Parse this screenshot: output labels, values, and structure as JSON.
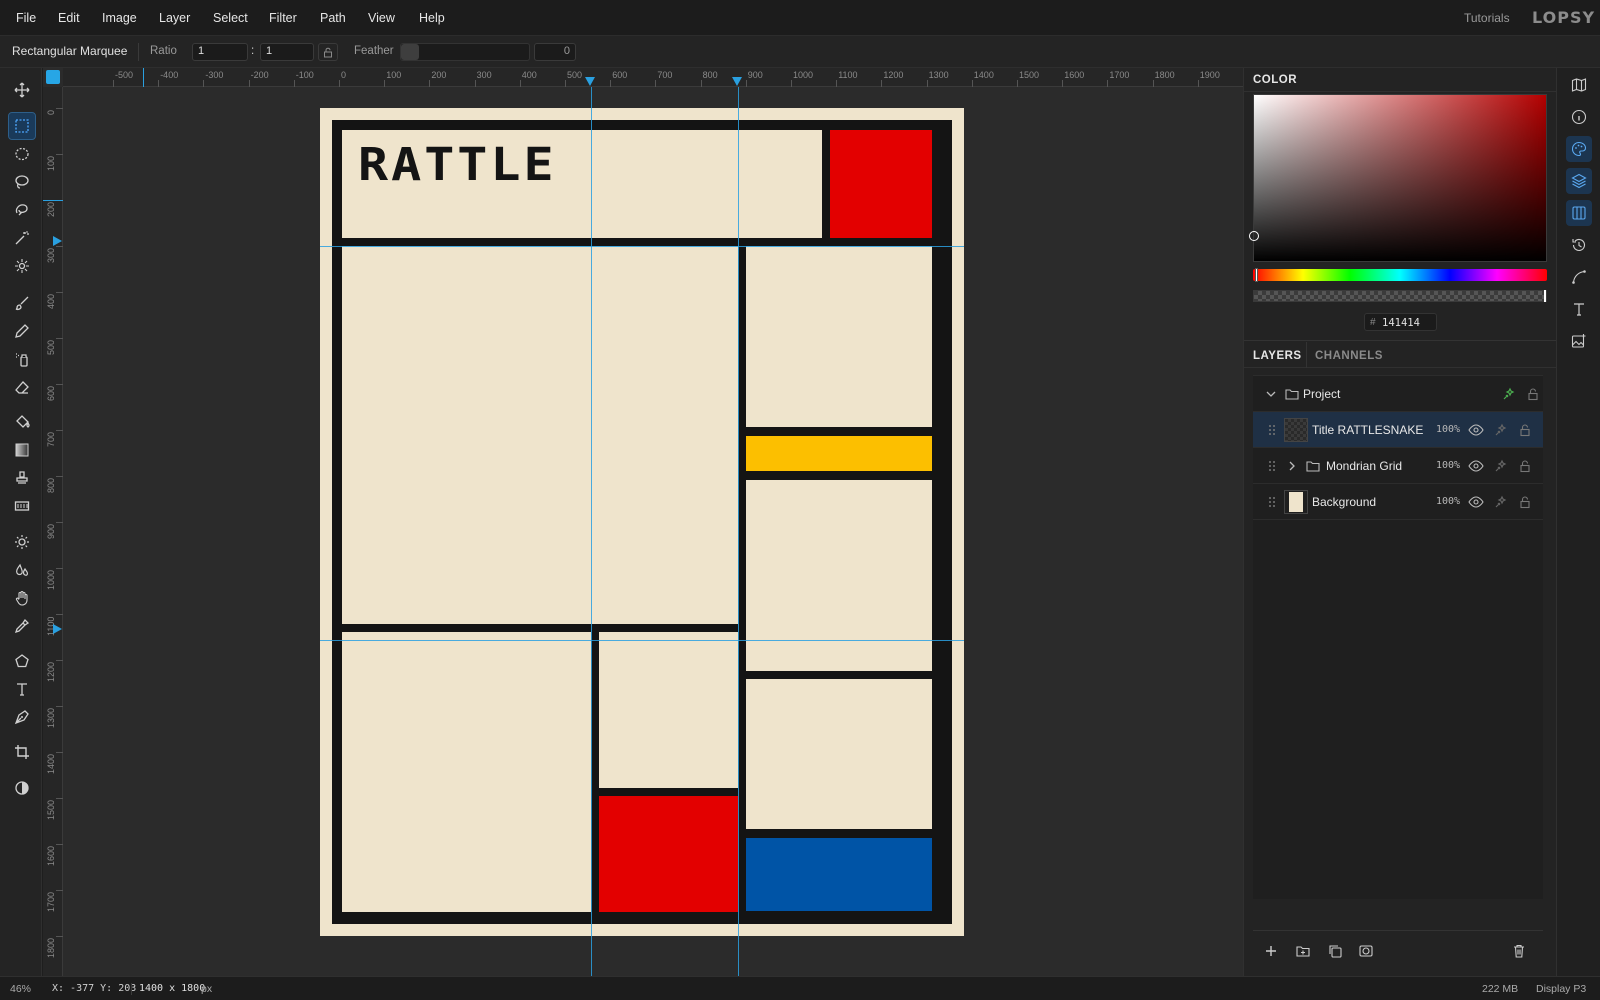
{
  "menubar": {
    "items": [
      "File",
      "Edit",
      "Image",
      "Layer",
      "Select",
      "Filter",
      "Path",
      "View",
      "Help"
    ],
    "tutorials": "Tutorials",
    "logo": "LOPSY"
  },
  "options": {
    "tool_name": "Rectangular Marquee",
    "ratio_label": "Ratio",
    "ratio_w": "1",
    "ratio_sep": ":",
    "ratio_h": "1",
    "feather_label": "Feather",
    "feather_value": "0"
  },
  "tools": [
    "move-tool",
    "rect-marquee-tool",
    "ellipse-marquee-tool",
    "lasso-tool",
    "magnetic-lasso-tool",
    "magic-wand-tool",
    "quick-select-tool",
    "brush-tool",
    "pencil-tool",
    "spray-tool",
    "eraser-tool",
    "fill-tool",
    "gradient-tool",
    "stamp-tool",
    "pattern-tool",
    "dodge-tool",
    "blur-tool",
    "hand-tool",
    "eyedropper-tool",
    "polygon-tool",
    "text-tool",
    "pen-tool",
    "crop-tool",
    "contrast-toggle"
  ],
  "ruler": {
    "top_labels": [
      "-500",
      "-400",
      "-300",
      "-200",
      "-100",
      "0",
      "100",
      "200",
      "300",
      "400",
      "500",
      "600",
      "700",
      "800",
      "900",
      "1000",
      "1100",
      "1200",
      "1300",
      "1400",
      "1500",
      "1600",
      "1700",
      "1800",
      "1900"
    ],
    "left_labels": [
      "0",
      "100",
      "200",
      "300",
      "400",
      "500",
      "600",
      "700",
      "800",
      "900",
      "1000",
      "1100",
      "1200",
      "1300",
      "1400",
      "1500",
      "1600",
      "1700",
      "1800"
    ]
  },
  "document": {
    "title_text": "RATTLE",
    "colors": {
      "background": "#efe4cc",
      "black": "#141414",
      "red": "#e30000",
      "yellow": "#fcbf00",
      "blue": "#0054a6",
      "guide": "#2aa0e0"
    }
  },
  "color_panel": {
    "tab": "COLOR",
    "hex_prefix": "#",
    "hex_value": "141414"
  },
  "layers_panel": {
    "tabs": [
      "LAYERS",
      "CHANNELS"
    ],
    "group_name": "Project",
    "layers": [
      {
        "name": "Title RATTLESNAKE",
        "opacity": "100%"
      },
      {
        "name": "Mondrian Grid",
        "opacity": "100%"
      },
      {
        "name": "Background",
        "opacity": "100%"
      }
    ]
  },
  "status": {
    "zoom": "46%",
    "coords": "X: -377 Y: 203",
    "size": "1400 x 1800",
    "size_unit": "px",
    "memory": "222 MB",
    "color_profile": "Display P3"
  }
}
